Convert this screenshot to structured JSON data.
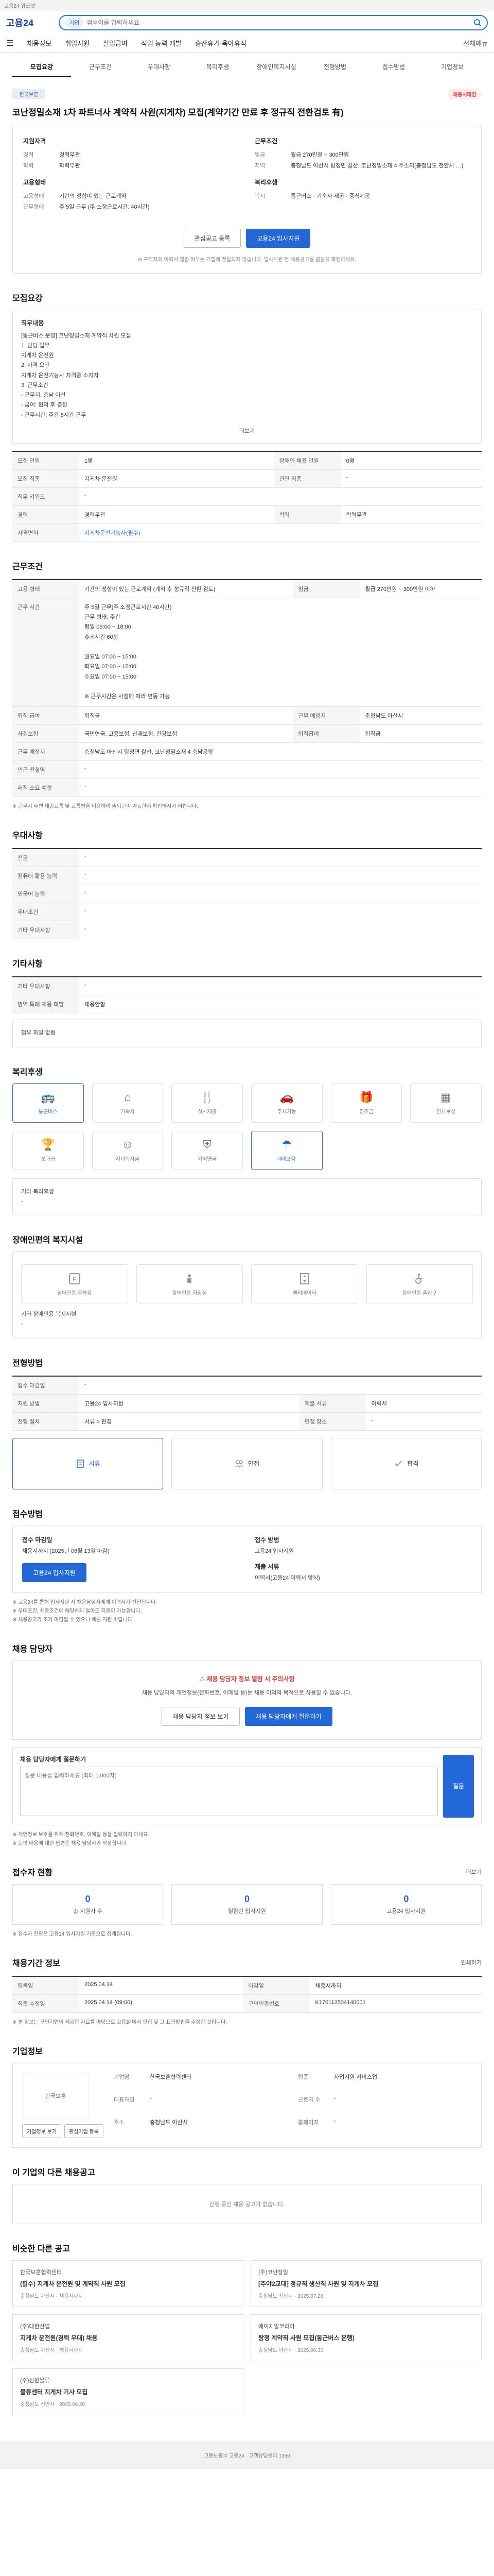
{
  "topbar": {
    "text": "고용24 워크넷"
  },
  "header": {
    "logo": "고용24",
    "search_tag": "기업",
    "search_placeholder": "검색어를 입력하세요",
    "nav": [
      "채용정보",
      "취업지원",
      "실업급여",
      "직업 능력 개발",
      "출산휴가·육아휴직"
    ],
    "right_label": "전체메뉴"
  },
  "tabs": [
    "모집요강",
    "근무조건",
    "우대사항",
    "복리후생",
    "장애인복지시설",
    "전형방법",
    "접수방법",
    "기업정보"
  ],
  "notice": {
    "company": "한국보훈",
    "badge": "채용시마감",
    "title": "코난정밀소재 1차 파트너사 계약직 사원(지게차) 모집(계약기간 만료 후 정규직 전환검토 有)"
  },
  "summary": {
    "left_title": "지원자격",
    "left": [
      {
        "k": "경력",
        "v": "경력무관"
      },
      {
        "k": "학력",
        "v": "학력무관"
      }
    ],
    "left2_title": "고용형태",
    "left2": [
      {
        "k": "고용형태",
        "v": "기간의 정함이 있는 근로계약"
      },
      {
        "k": "근무형태",
        "v": "주 5일 근무 (주 소정근로시간: 40시간)"
      }
    ],
    "right_title": "근무조건",
    "right": [
      {
        "k": "임금",
        "v": "월급 270만원 ~ 300만원"
      },
      {
        "k": "지역",
        "v": "충청남도 아산시 탕정면 갈산, 코난정밀소재 4 주소지(충청남도 천안시 …)"
      }
    ],
    "right2_title": "복리후생",
    "right2": [
      {
        "k": "복지",
        "v": "통근버스 · 기숙사 제공 · 중식제공"
      }
    ],
    "apply_label": "관심공고 등록",
    "online_label": "고용24 입사지원",
    "note": "※ 구직자의 이력서 열람 여부는 기업에 전달되지 않습니다. 입사지원 전 채용공고를 꼼꼼히 확인하세요."
  },
  "recruit": {
    "title": "모집요강",
    "job_title": "직무내용",
    "job_text": "[통근버스 운영] 코난정밀소재 계약직 사원 모집\n1. 담당 업무\n지게차 운전원\n2. 자격 요건\n지게차 운전기능사 자격증 소지자\n3. 근무조건\n- 근무지: 충남 아산\n- 급여: 협의 후 결정\n- 근무시간: 주간 8시간 근무",
    "more_label": "더보기",
    "rows": [
      {
        "k": "모집 인원",
        "v": "1명",
        "k2": "장애인 채용 인원",
        "v2": "0명"
      },
      {
        "k": "모집 직종",
        "v": "지게차 운전원",
        "k2": "관련 직종",
        "v2": "-"
      },
      {
        "k": "직무 키워드",
        "v": "-",
        "k2": "",
        "v2": ""
      },
      {
        "k": "경력",
        "v": "경력무관",
        "k2": "학력",
        "v2": "학력무관"
      },
      {
        "k": "자격면허",
        "v": "지게차운전기능사(필수)",
        "k2": "",
        "v2": ""
      }
    ]
  },
  "work": {
    "title": "근무조건",
    "rows": [
      {
        "k": "고용 형태",
        "v": "기간의 정함이 있는 근로계약 (계약 후 정규직 전환 검토)",
        "k2": "임금",
        "v2": "월급 270만원 ~ 300만원 이하"
      },
      {
        "k": "근무 시간",
        "v": "주 5일 근무(주 소정근로시간 40시간)\n근무 형태: 주간\n평일 09:00 ~ 18:00\n휴게시간 60분\n\n월요일 07:00 ~ 15:00\n화요일 07:00 ~ 15:00\n수요일 07:00 ~ 15:00\n\n※ 근무시간은 사정에 따라 변동 가능",
        "k2": "",
        "v2": ""
      },
      {
        "k": "퇴직 급여",
        "v": "퇴직금",
        "k2": "근무 예정지",
        "v2": "충청남도 아산시"
      },
      {
        "k": "사회보험",
        "v": "국민연금, 고용보험, 산재보험, 건강보험",
        "k2": "퇴직급여",
        "v2": "퇴직금"
      },
      {
        "k": "근무 예정지",
        "v": "충청남도 아산시 탕정면 갈산, 코난정밀소재 4 충남공장",
        "k2": "",
        "v2": ""
      },
      {
        "k": "인근 전철역",
        "v": "-",
        "k2": "",
        "v2": ""
      },
      {
        "k": "재직 소요 예정",
        "v": "-",
        "k2": "",
        "v2": ""
      }
    ],
    "note": "※ 근무지 주변 대중교통 및 교통편을 이용하여 출퇴근이 가능한지 확인하시기 바랍니다."
  },
  "prefer": {
    "title": "우대사항",
    "rows": [
      {
        "k": "전공",
        "v": "-"
      },
      {
        "k": "컴퓨터 활용 능력",
        "v": "-"
      },
      {
        "k": "외국어 능력",
        "v": "-"
      },
      {
        "k": "우대조건",
        "v": "-"
      },
      {
        "k": "기타 우대사항",
        "v": "-"
      }
    ]
  },
  "etc": {
    "title": "기타사항",
    "rows": [
      {
        "k": "기타 우대사항",
        "v": "-"
      },
      {
        "k": "병역 특례 채용 희망",
        "v": "채용안함"
      }
    ],
    "attach": "첨부 파일 없음"
  },
  "welfare": {
    "title": "복리후생",
    "items": [
      {
        "icon": "bus-icon",
        "label": "통근버스",
        "on": true
      },
      {
        "icon": "home-icon",
        "label": "기숙사",
        "on": false
      },
      {
        "icon": "meal-icon",
        "label": "식사제공",
        "on": false
      },
      {
        "icon": "car-icon",
        "label": "주차가능",
        "on": false
      },
      {
        "icon": "gift-icon",
        "label": "경조금",
        "on": false
      },
      {
        "icon": "calendar-icon",
        "label": "연차보상",
        "on": false
      },
      {
        "icon": "trophy-icon",
        "label": "성과급",
        "on": false
      },
      {
        "icon": "child-icon",
        "label": "자녀학자금",
        "on": false
      },
      {
        "icon": "shield-icon",
        "label": "퇴직연금",
        "on": false
      },
      {
        "icon": "umbrella-icon",
        "label": "4대보험",
        "on": true
      }
    ],
    "other": "기타 복리후생\n-"
  },
  "disabled": {
    "title": "장애인편의 복지시설",
    "items": [
      "장애인용 주차장",
      "장애인용 화장실",
      "엘리베이터",
      "장애인용 출입구"
    ],
    "other": "기타 장애인용 복지시설\n-"
  },
  "process": {
    "title": "전형방법",
    "rows": [
      {
        "k": "접수 마감일",
        "v": "-"
      },
      {
        "k": "지원 방법",
        "v": "고용24 입사지원",
        "k2": "제출 서류",
        "v2": "이력서"
      },
      {
        "k": "전형 절차",
        "v": "서류 > 면접",
        "k2": "면접 장소",
        "v2": "-"
      }
    ],
    "steps": [
      "서류",
      "면접",
      "합격"
    ]
  },
  "apply": {
    "title": "접수방법",
    "left_h": "접수 마감일",
    "left_t": "채용시까지 (2025년 06월 13일 마감)",
    "right_h": "접수 방법",
    "right_t": "고용24 입사지원",
    "doc_h": "제출 서류",
    "doc_t": "이력서(고용24 이력서 양식)",
    "btn": "고용24 입사지원",
    "notes": "※ 고용24를 통해 입사지원 시 채용담당자에게 이력서가 전달됩니다.\n※ 우대조건, 채용조건에 해당하지 않아도 지원이 가능합니다.\n※ 채용공고가 조기 마감될 수 있으니 빠른 지원 바랍니다."
  },
  "contact": {
    "title": "채용 담당자",
    "warn": "채용 담당자 정보 열람 시 주의사항",
    "text": "채용 담당자의 개인정보(전화번호, 이메일 등)는 채용 이외의 목적으로 사용할 수 없습니다.",
    "btn1": "채용 담당자 정보 보기",
    "btn2": "채용 담당자에게 질문하기"
  },
  "qna": {
    "title": "채용 담당자에게 질문하기",
    "placeholder": "질문 내용을 입력하세요 (최대 1,000자)",
    "btn": "질문",
    "notes": "※ 개인정보 보호를 위해 전화번호, 이메일 등을 입력하지 마세요.\n※ 문의 내용에 대한 답변은 채용 담당자가 작성합니다."
  },
  "stats": {
    "title": "접수자 현황",
    "link": "더보기",
    "cards": [
      {
        "n": "0",
        "l": "총 지원자 수"
      },
      {
        "n": "0",
        "l": "열람한 입사지원"
      },
      {
        "n": "0",
        "l": "고용24 입사지원"
      }
    ],
    "note": "※ 접수자 현황은 고용24 입사지원 기준으로 집계됩니다."
  },
  "posting": {
    "title": "채용기간 정보",
    "link": "인쇄하기",
    "rows": [
      {
        "k": "등록일",
        "v": "2025.04.14",
        "k2": "마감일",
        "v2": "채용시까지"
      },
      {
        "k": "최종 수정일",
        "v": "2025.04.14 (09:00)",
        "k2": "구인인증번호",
        "v2": "K170112504140001"
      }
    ],
    "note": "※ 본 정보는 구인기업이 제공한 자료를 바탕으로 고용24에서 편집 및 그 표현방법을 수정한 것입니다."
  },
  "company": {
    "title": "기업정보",
    "logo": "한국보훈",
    "rows": [
      {
        "k": "기업명",
        "v": "한국보훈협력센터"
      },
      {
        "k": "업종",
        "v": "사업지원 서비스업"
      },
      {
        "k": "대표자명",
        "v": "-"
      },
      {
        "k": "근로자 수",
        "v": "-"
      },
      {
        "k": "주소",
        "v": "충청남도 아산시"
      },
      {
        "k": "홈페이지",
        "v": "-"
      }
    ],
    "btn1": "기업정보 보기",
    "btn2": "관심기업 등록"
  },
  "other_jobs": {
    "title": "이 기업의 다른 채용공고",
    "empty": "진행 중인 채용 공고가 없습니다."
  },
  "recommended": {
    "title": "비슷한 다른 공고",
    "items": [
      {
        "co": "한국보훈협력센터",
        "title": "(필수) 지게차 운전원 및 계약직 사원 모집",
        "meta": "충청남도 아산시 · 채용시까지"
      },
      {
        "co": "(주)코난정밀",
        "title": "[주야2교대] 정규직 생산직 사원 및 지게차 모집",
        "meta": "충청남도 천안시 · 2025.07.28"
      },
      {
        "co": "(주)대한산업",
        "title": "지게차 운전원(경력 우대) 채용",
        "meta": "충청남도 아산시 · 채용시까지"
      },
      {
        "co": "에이치알코리아",
        "title": "탕정 계약직 사원 모집(통근버스 운행)",
        "meta": "충청남도 아산시 · 2025.06.30"
      },
      {
        "co": "(주)신원물류",
        "title": "물류센터 지게차 기사 모집",
        "meta": "충청남도 천안시 · 2025.06.20"
      }
    ]
  },
  "footer": {
    "text": "고용노동부 고용24 · 고객상담센터 1350"
  }
}
